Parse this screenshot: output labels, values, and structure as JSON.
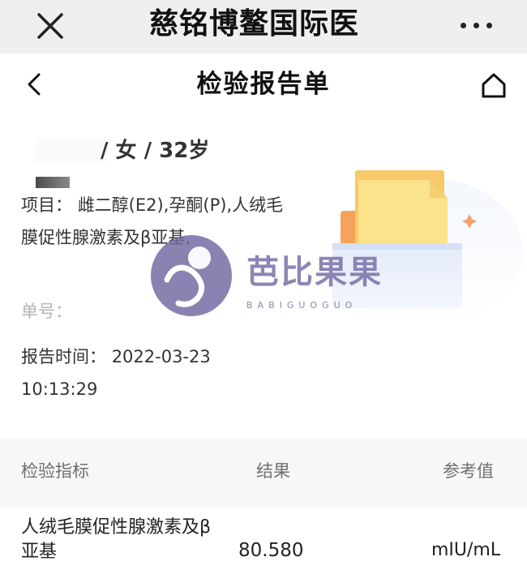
{
  "wechat_bar": {
    "title": "慈铭博鳌国际医",
    "close_icon": "close-icon",
    "more_icon": "more-dots-icon"
  },
  "header": {
    "title": "检验报告单",
    "back_icon": "chevron-left-icon",
    "home_icon": "home-icon"
  },
  "patient": {
    "gender_age": "/ 女 / 32岁"
  },
  "info": {
    "items_label": "项目：",
    "items_value": "雌二醇(E2),孕酮(P),人绒毛膜促性腺激素及β亚基,",
    "order_label": "单号：",
    "time_label": "报告时间：",
    "time_value": "2022-03-23 10:13:29"
  },
  "watermark": {
    "text": "芭比果果",
    "sub": "BABIGUOGUO"
  },
  "table": {
    "headers": [
      "检验指标",
      "结果",
      "参考值"
    ],
    "rows": [
      {
        "name": "人绒毛膜促性腺激素及β亚基",
        "result": "80.580",
        "ref": "mIU/mL"
      }
    ]
  },
  "colors": {
    "bar_bg": "#efefef",
    "table_head_bg": "#f7f7f7",
    "watermark": "#7068a0"
  }
}
